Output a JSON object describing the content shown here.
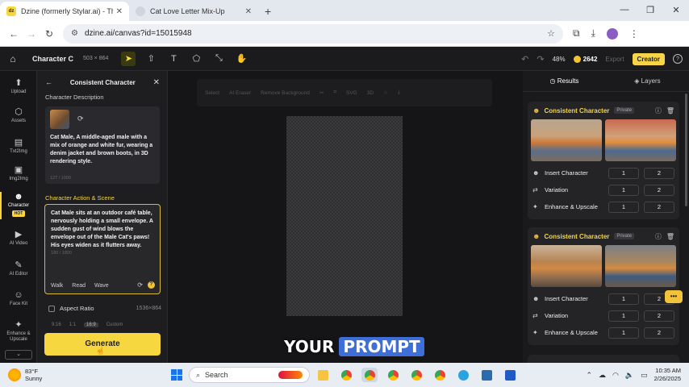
{
  "browser": {
    "tabs": [
      {
        "title": "Dzine (formerly Stylar.ai) - The",
        "favicon": "dz",
        "active": true
      },
      {
        "title": "Cat Love Letter Mix-Up",
        "active": false
      }
    ],
    "url": "dzine.ai/canvas?id=15015948"
  },
  "toolbar": {
    "project_name": "Character C",
    "canvas_size": "503 × 864",
    "zoom": "48%",
    "credits": "2642",
    "export_label": "Export",
    "creator_label": "Creator"
  },
  "rail": {
    "items": [
      {
        "label": "Upload",
        "icon": "upload-icon"
      },
      {
        "label": "Assets",
        "icon": "assets-icon"
      },
      {
        "label": "Txt2Img",
        "icon": "txt2img-icon"
      },
      {
        "label": "Img2Img",
        "icon": "img2img-icon"
      },
      {
        "label": "Character",
        "icon": "character-icon",
        "badge": "HOT"
      },
      {
        "label": "AI Video",
        "icon": "video-icon"
      },
      {
        "label": "AI Editor",
        "icon": "editor-icon"
      },
      {
        "label": "Face Kit",
        "icon": "face-icon"
      },
      {
        "label": "Enhance & Upscale",
        "icon": "enhance-icon"
      }
    ]
  },
  "panel": {
    "title": "Consistent Character",
    "description_title": "Character Description",
    "description": "Cat Male, A middle-aged male with a mix of orange and white fur, wearing a denim jacket and brown boots, in 3D rendering style.",
    "description_count": "127 / 1000",
    "scene_title": "Character Action & Scene",
    "scene_text": "Cat Male sits at an outdoor café table, nervously holding a small envelope. A sudden gust of wind blows the envelope out of the Male Cat's paws! His eyes widen as it flutters away.",
    "scene_count": "180 / 1800",
    "scene_tags": [
      "Walk",
      "Read",
      "Wave"
    ],
    "aspect_label": "Aspect Ratio",
    "aspect_value": "1536×864",
    "ratios": [
      "9:16",
      "1:1",
      "16:9",
      "Custom"
    ],
    "generate_label": "Generate"
  },
  "canvas": {
    "context_tools": [
      "Select",
      "AI Eraser",
      "Remove Background",
      "",
      "",
      "SVG",
      "3D"
    ],
    "caption": [
      "YOUR",
      "PROMPT"
    ]
  },
  "results": {
    "tabs": [
      "Results",
      "Layers"
    ],
    "cards": [
      {
        "title": "Consistent Character",
        "badge": "Private",
        "rows": [
          {
            "label": "Insert Character",
            "icon": "insert-icon",
            "a": "1",
            "b": "2"
          },
          {
            "label": "Variation",
            "icon": "variation-icon",
            "a": "1",
            "b": "2"
          },
          {
            "label": "Enhance & Upscale",
            "icon": "upscale-icon",
            "a": "1",
            "b": "2"
          }
        ]
      },
      {
        "title": "Consistent Character",
        "badge": "Private",
        "rows": [
          {
            "label": "Insert Character",
            "icon": "insert-icon",
            "a": "1",
            "b": "2"
          },
          {
            "label": "Variation",
            "icon": "variation-icon",
            "a": "1",
            "b": "2"
          },
          {
            "label": "Enhance & Upscale",
            "icon": "upscale-icon",
            "a": "1",
            "b": "2"
          }
        ]
      }
    ]
  },
  "taskbar": {
    "temperature": "83°F",
    "condition": "Sunny",
    "search_placeholder": "Search",
    "time": "10:35 AM",
    "date": "2/26/2025"
  },
  "colors": {
    "accent": "#f7d740",
    "caption_highlight": "#3e6fd8"
  }
}
